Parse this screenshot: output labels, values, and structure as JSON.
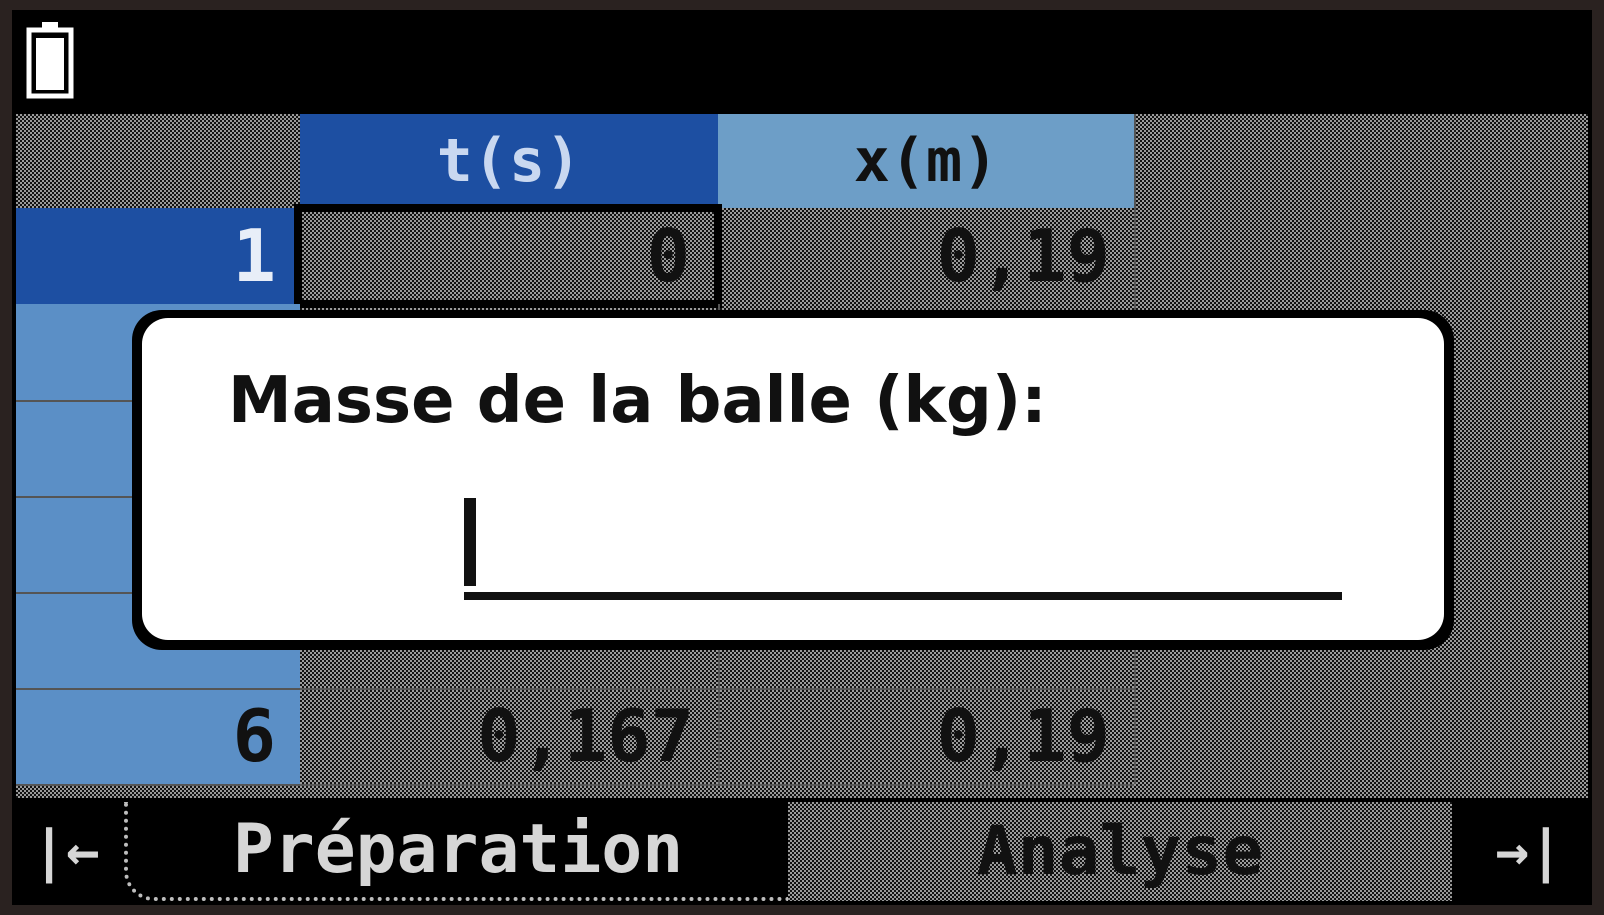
{
  "table": {
    "columns": [
      "t(s)",
      "x(m)"
    ],
    "rows": [
      {
        "index": "1",
        "t": "0",
        "x": "0,19"
      },
      {
        "index": "6",
        "t": "0,167",
        "x": "0,19"
      }
    ]
  },
  "dialog": {
    "prompt": "Masse de la balle (kg):",
    "value": ""
  },
  "tabs": {
    "prev_icon": "|←",
    "left": "Préparation",
    "right": "Analyse",
    "next_icon": "→|"
  },
  "icons": {
    "battery": "battery-icon"
  }
}
